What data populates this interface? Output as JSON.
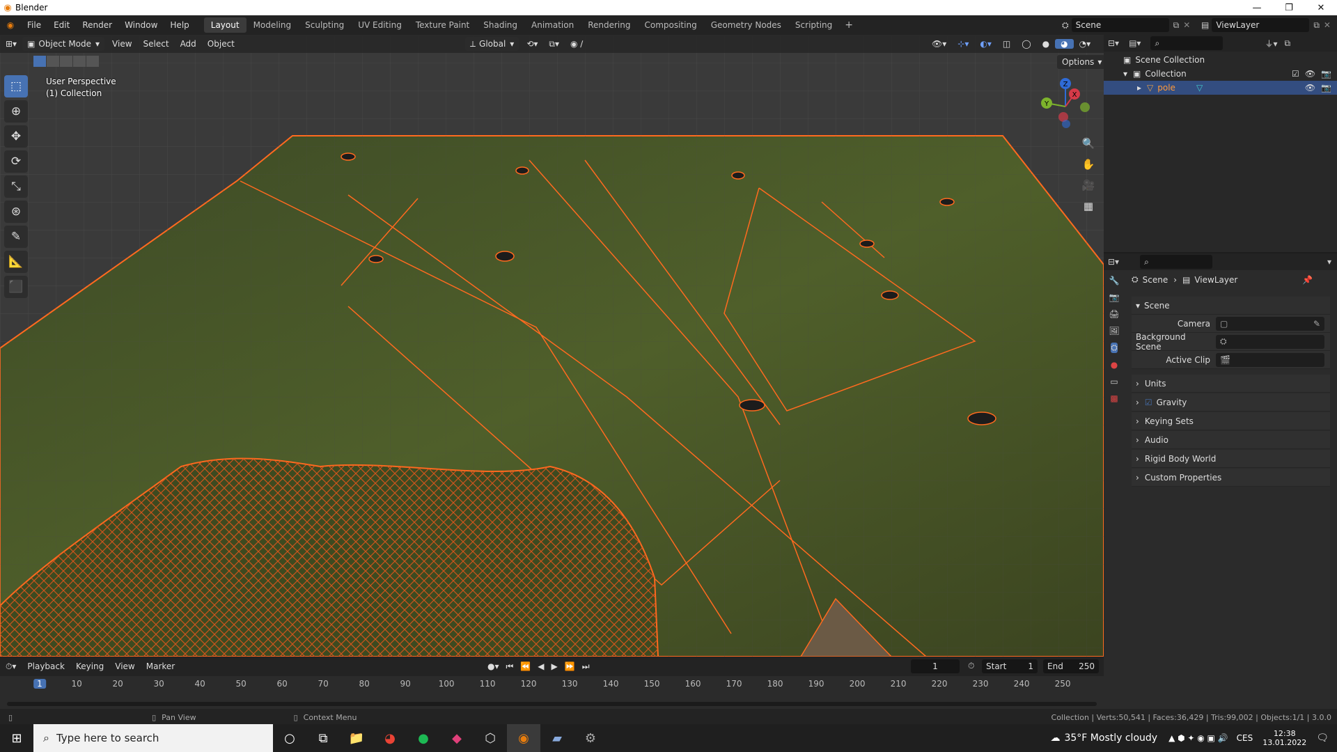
{
  "window": {
    "title": "Blender",
    "minimize": "—",
    "maximize": "❐",
    "close": "✕"
  },
  "menu": [
    "File",
    "Edit",
    "Render",
    "Window",
    "Help"
  ],
  "workspaces": [
    "Layout",
    "Modeling",
    "Sculpting",
    "UV Editing",
    "Texture Paint",
    "Shading",
    "Animation",
    "Rendering",
    "Compositing",
    "Geometry Nodes",
    "Scripting"
  ],
  "active_workspace": "Layout",
  "scene_field": "Scene",
  "viewlayer_field": "ViewLayer",
  "viewport": {
    "mode": "Object Mode",
    "menus": [
      "View",
      "Select",
      "Add",
      "Object"
    ],
    "orientation": "Global",
    "options_label": "Options",
    "info_line1": "User Perspective",
    "info_line2": "(1) Collection",
    "gizmo_x": "X",
    "gizmo_y": "Y",
    "gizmo_z": "Z"
  },
  "outliner": {
    "root": "Scene Collection",
    "collection": "Collection",
    "object": "pole"
  },
  "properties": {
    "breadcrumb_scene": "Scene",
    "breadcrumb_layer": "ViewLayer",
    "panel_title": "Scene",
    "camera_label": "Camera",
    "background_label": "Background Scene",
    "clip_label": "Active Clip",
    "sections": [
      "Units",
      "Gravity",
      "Keying Sets",
      "Audio",
      "Rigid Body World",
      "Custom Properties"
    ]
  },
  "timeline": {
    "menus": [
      "Playback",
      "Keying",
      "View",
      "Marker"
    ],
    "current_frame": "1",
    "start_label": "Start",
    "start_value": "1",
    "end_label": "End",
    "end_value": "250",
    "ticks": [
      "1",
      "10",
      "20",
      "30",
      "40",
      "50",
      "60",
      "70",
      "80",
      "90",
      "100",
      "110",
      "120",
      "130",
      "140",
      "150",
      "160",
      "170",
      "180",
      "190",
      "200",
      "210",
      "220",
      "230",
      "240",
      "250"
    ]
  },
  "status": {
    "pan": "Pan View",
    "context": "Context Menu",
    "stats": "Collection | Verts:50,541 | Faces:36,429 | Tris:99,002 | Objects:1/1 | 3.0.0"
  },
  "taskbar": {
    "search_placeholder": "Type here to search",
    "weather": "35°F  Mostly cloudy",
    "lang": "CES",
    "time": "12:38",
    "date": "13.01.2022"
  }
}
